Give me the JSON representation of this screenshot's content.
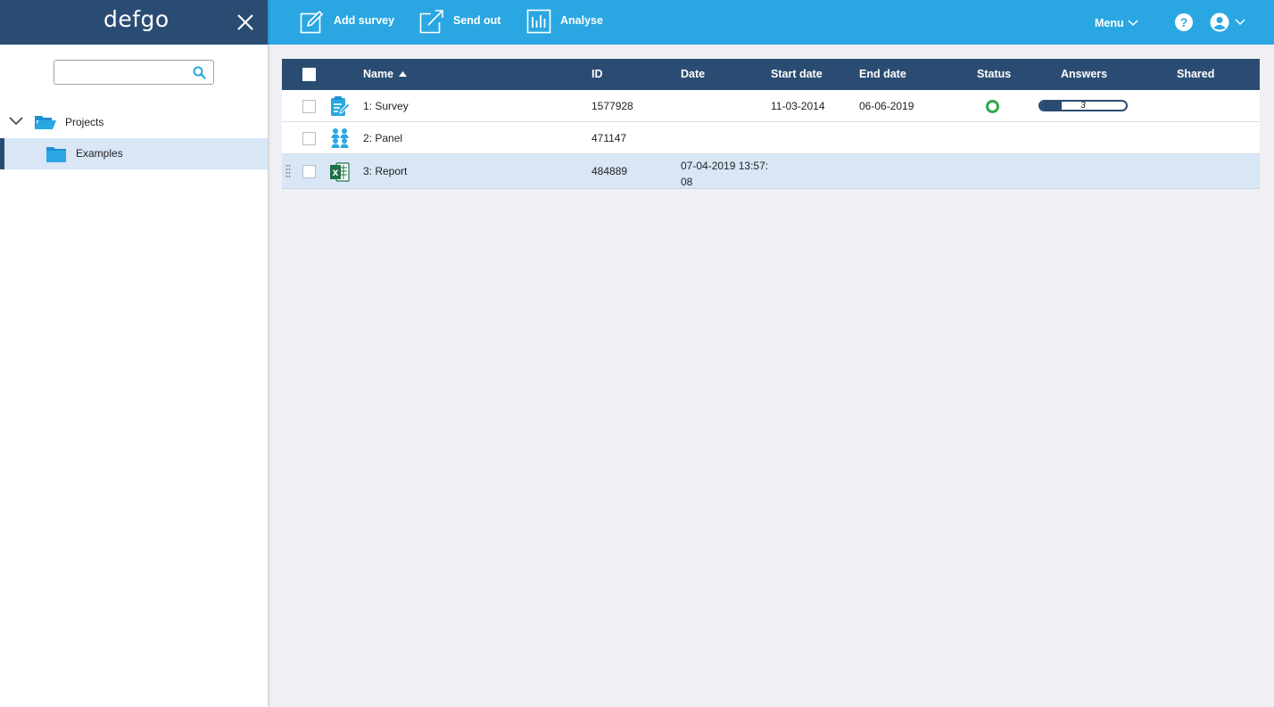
{
  "app": {
    "logo": "defgo"
  },
  "sidebar": {
    "search": {
      "value": "",
      "placeholder": ""
    },
    "tree": [
      {
        "label": "Projects",
        "expanded": true,
        "icon": "folder-open-icon"
      },
      {
        "label": "Examples",
        "selected": true,
        "icon": "folder-icon"
      }
    ]
  },
  "toolbar": {
    "add_survey": "Add survey",
    "send_out": "Send out",
    "analyse": "Analyse",
    "menu": "Menu",
    "help": "?"
  },
  "table": {
    "columns": {
      "name": "Name",
      "id": "ID",
      "date": "Date",
      "start_date": "Start date",
      "end_date": "End date",
      "status": "Status",
      "answers": "Answers",
      "shared": "Shared"
    },
    "sort": {
      "column": "Name",
      "direction": "ascending"
    },
    "rows": [
      {
        "name": "1: Survey",
        "id": "1577928",
        "date": "",
        "start_date": "11-03-2014",
        "end_date": "06-06-2019",
        "status": "active",
        "answers": "3",
        "answers_fraction": 0.25,
        "shared": "",
        "icon": "survey-clipboard-icon"
      },
      {
        "name": "2: Panel",
        "id": "471147",
        "date": "",
        "start_date": "",
        "end_date": "",
        "status": "",
        "answers": "",
        "shared": "",
        "icon": "panel-people-icon"
      },
      {
        "name": "3: Report",
        "id": "484889",
        "date": "07-04-2019 13:57:\n08",
        "start_date": "",
        "end_date": "",
        "status": "",
        "answers": "",
        "shared": "",
        "icon": "excel-report-icon",
        "selected": true
      }
    ]
  },
  "colors": {
    "sidebar_header": "#2b4c72",
    "topbar": "#2aa7e2",
    "table_header": "#2b4c72",
    "selected_row": "#d8e6f6",
    "status_active": "#2fa94a",
    "background": "#eef0f4"
  }
}
